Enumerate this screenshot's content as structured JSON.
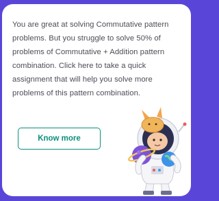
{
  "card": {
    "message": "You are great at solving Commutative pattern problems. But you struggle to solve 50% of problems of Commutative + Addition pattern combination. Click here to take a quick assignment that will help you solve more problems of this pattern combination.",
    "button_label": "Know more"
  },
  "colors": {
    "background": "#5946d8",
    "accent": "#0b8f7b"
  },
  "icons": [
    "astronaut-illustration"
  ]
}
